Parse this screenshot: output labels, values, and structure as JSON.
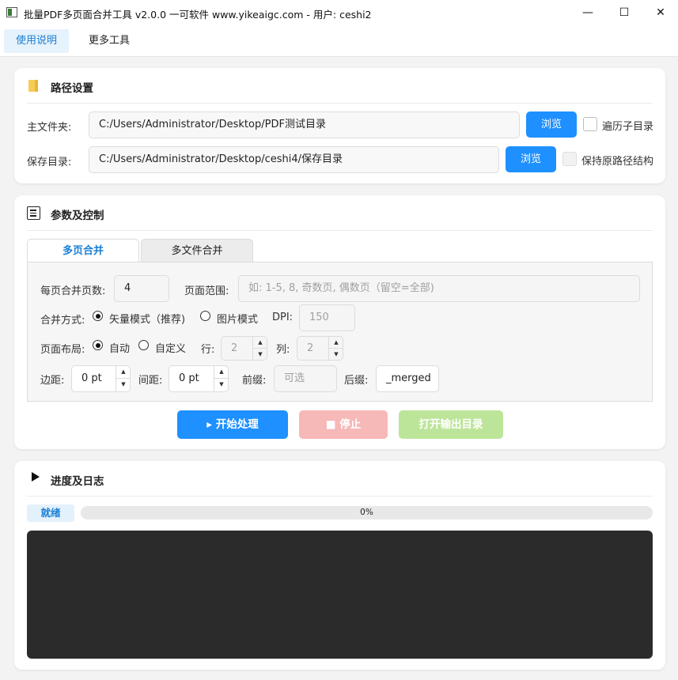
{
  "window": {
    "title": "批量PDF多页面合并工具 v2.0.0 一可软件 www.yikeaigc.com - 用户: ceshi2",
    "minimize": "—",
    "maximize": "☐",
    "close": "✕"
  },
  "menu": {
    "items": [
      "使用说明",
      "更多工具"
    ],
    "active_index": 0
  },
  "paths": {
    "title": "路径设置",
    "main_label": "主文件夹:",
    "main_value": "C:/Users/Administrator/Desktop/PDF测试目录",
    "save_label": "保存目录:",
    "save_value": "C:/Users/Administrator/Desktop/ceshi4/保存目录",
    "browse_label": "浏览",
    "recurse_label": "遍历子目录",
    "recurse_checked": false,
    "keep_structure_label": "保持原路径结构",
    "keep_structure_checked": false
  },
  "params": {
    "title": "参数及控制",
    "tabs": [
      "多页合并",
      "多文件合并"
    ],
    "active_tab": 0,
    "pages_per_sheet_label": "每页合并页数:",
    "pages_per_sheet_value": "4",
    "page_range_label": "页面范围:",
    "page_range_placeholder": "如: 1-5, 8, 奇数页, 偶数页（留空=全部)",
    "merge_mode_label": "合并方式:",
    "mode_vector_label": "矢量模式（推荐)",
    "mode_image_label": "图片模式",
    "mode_selected": "vector",
    "dpi_label": "DPI:",
    "dpi_value": "150",
    "layout_label": "页面布局:",
    "layout_auto_label": "自动",
    "layout_custom_label": "自定义",
    "layout_selected": "auto",
    "rows_label": "行:",
    "rows_value": "2",
    "cols_label": "列:",
    "cols_value": "2",
    "margin_label": "边距:",
    "margin_value": "0 pt",
    "spacing_label": "间距:",
    "spacing_value": "0 pt",
    "prefix_label": "前缀:",
    "prefix_placeholder": "可选",
    "suffix_label": "后缀:",
    "suffix_value": "_merged",
    "start_label": "▸ 开始处理",
    "stop_label": "■ 停止",
    "open_output_label": "打开输出目录",
    "colors": {
      "start": "#1e90ff",
      "stop": "#f7b8b8",
      "open": "#bde59a"
    }
  },
  "progress": {
    "title": "进度及日志",
    "status": "就绪",
    "percent_text": "0%",
    "fraction": 0,
    "log": ""
  }
}
